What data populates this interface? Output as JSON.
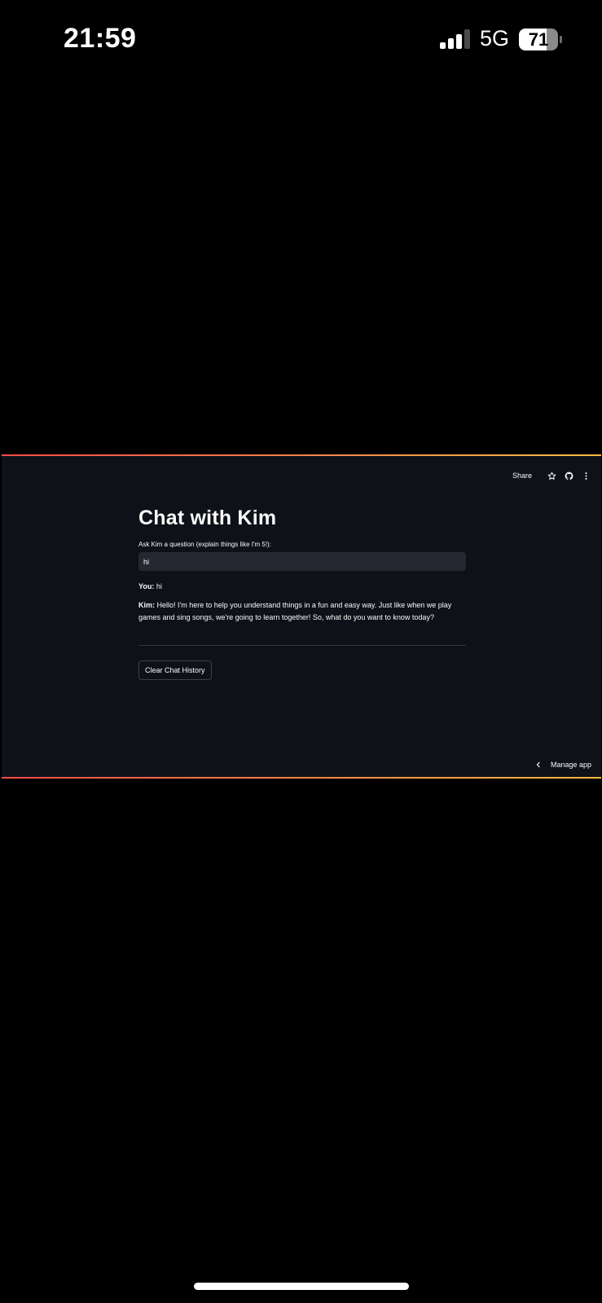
{
  "status_bar": {
    "time": "21:59",
    "network": "5G",
    "battery_percent": "71",
    "signal_bars_active": 3,
    "signal_bars_total": 4
  },
  "toolbar": {
    "share_label": "Share",
    "icons": [
      "star-icon",
      "github-icon",
      "more-vertical-icon"
    ]
  },
  "main": {
    "title": "Chat with Kim",
    "input_label": "Ask Kim a question (explain things like I'm 5!):",
    "input_value": "hi",
    "messages": [
      {
        "speaker": "You:",
        "text": " hi"
      },
      {
        "speaker": "Kim:",
        "text": " Hello! I'm here to help you understand things in a fun and easy way. Just like when we play games and sing songs, we're going to learn together! So, what do you want to know today?"
      }
    ],
    "clear_button_label": "Clear Chat History"
  },
  "footer": {
    "manage_app_label": "Manage app"
  },
  "colors": {
    "app_background": "#0e1117",
    "input_background": "#262730",
    "accent_start": "#ff4b4b",
    "accent_end": "#ffbd45"
  }
}
